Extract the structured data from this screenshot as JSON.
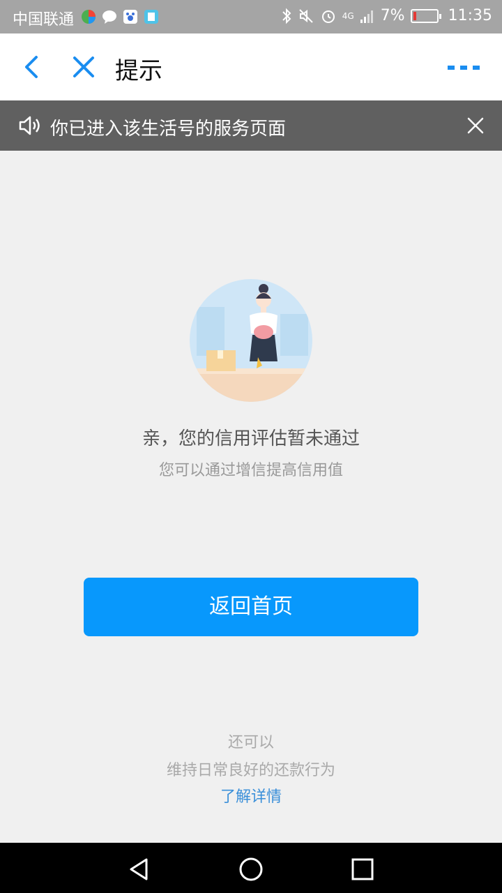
{
  "status_bar": {
    "carrier": "中国联通",
    "signal": "4G",
    "battery_percent": "7%",
    "time": "11:35"
  },
  "nav": {
    "title": "提示"
  },
  "notice": {
    "text": "你已进入该生活号的服务页面"
  },
  "main": {
    "message": "亲，您的信用评估暂未通过",
    "sub_message": "您可以通过增信提高信用值",
    "home_button": "返回首页"
  },
  "footer": {
    "line1": "还可以",
    "line2": "维持日常良好的还款行为",
    "link": "了解详情"
  },
  "colors": {
    "accent": "#0898fc",
    "link": "#3a8fd9",
    "notice_bg": "#606060"
  }
}
